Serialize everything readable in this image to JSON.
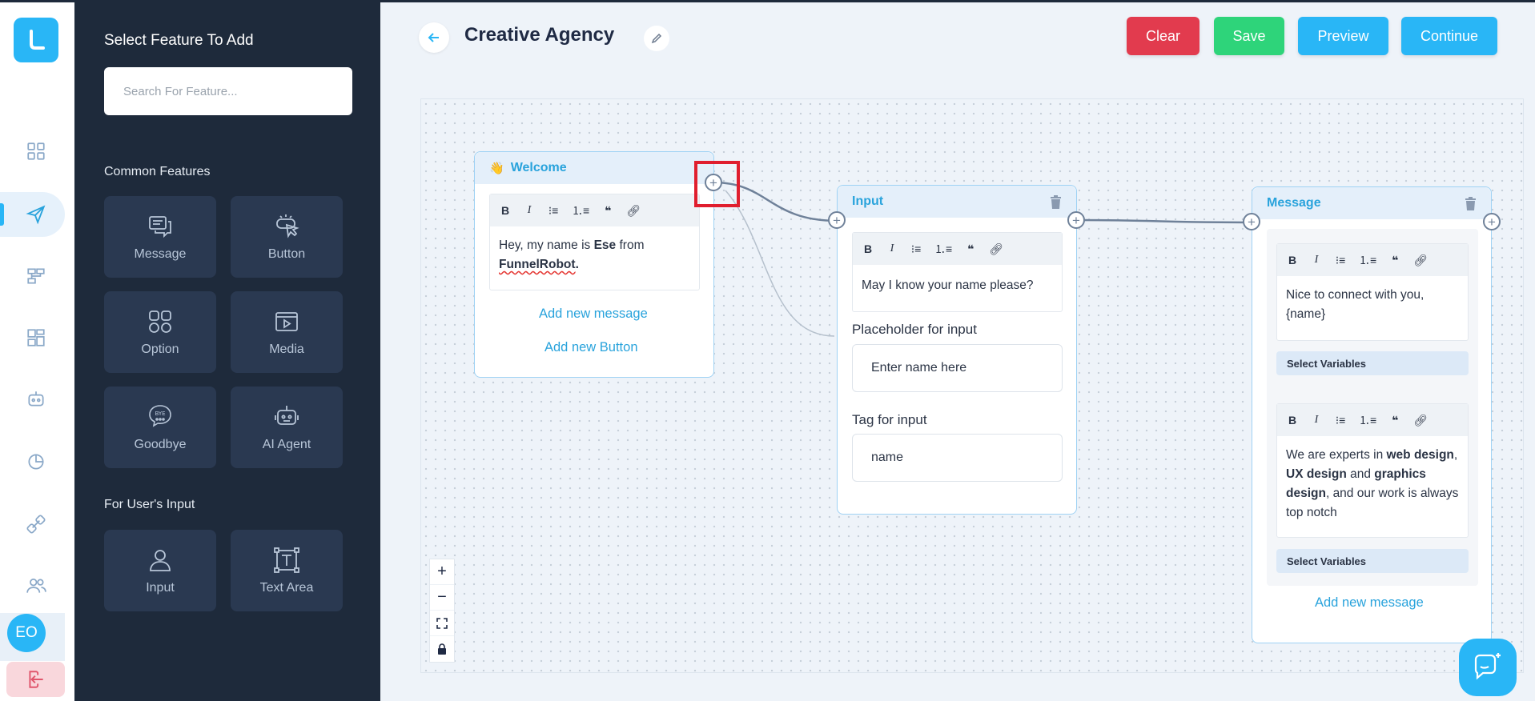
{
  "app": {
    "avatar_initials": "EO",
    "accent_color": "#29b6f6"
  },
  "panel": {
    "title": "Select Feature To Add",
    "search_placeholder": "Search For Feature...",
    "common_title": "Common Features",
    "common": [
      {
        "label": "Message",
        "icon": "message-icon"
      },
      {
        "label": "Button",
        "icon": "button-click-icon"
      },
      {
        "label": "Option",
        "icon": "option-grid-icon"
      },
      {
        "label": "Media",
        "icon": "media-icon"
      },
      {
        "label": "Goodbye",
        "icon": "goodbye-icon"
      },
      {
        "label": "AI Agent",
        "icon": "robot-icon"
      }
    ],
    "user_input_title": "For User's Input",
    "user_input": [
      {
        "label": "Input",
        "icon": "user-icon"
      },
      {
        "label": "Text Area",
        "icon": "text-area-icon"
      }
    ]
  },
  "header": {
    "title": "Creative Agency",
    "buttons": {
      "clear": "Clear",
      "save": "Save",
      "preview": "Preview",
      "continue": "Continue"
    },
    "colors": {
      "clear": "#e23b4e",
      "save": "#2ed47a",
      "preview": "#29b6f6",
      "continue": "#29b6f6"
    }
  },
  "nodes": {
    "welcome": {
      "title": "Welcome",
      "emoji": "👋",
      "text_pre": "Hey, my name is ",
      "text_bold": "Ese",
      "text_mid": " from ",
      "text_brand": "FunnelRobot",
      "text_end": ".",
      "add_message": "Add new message",
      "add_button": "Add new Button"
    },
    "input": {
      "title": "Input",
      "question": "May I know your name please?",
      "placeholder_label": "Placeholder for input",
      "placeholder_value": "Enter name here",
      "tag_label": "Tag for input",
      "tag_value": "name"
    },
    "message": {
      "title": "Message",
      "msg1": "Nice to connect with you, {name}",
      "select_variables": "Select Variables",
      "msg2_parts": [
        "We are experts in ",
        "web design",
        ", ",
        "UX design",
        " and ",
        "graphics design",
        ", and our work is always top notch"
      ],
      "add_message": "Add new message"
    }
  },
  "toolbar": [
    "B",
    "I",
    "bullet-list-icon",
    "numbered-list-icon",
    "quote-icon",
    "link-icon"
  ]
}
